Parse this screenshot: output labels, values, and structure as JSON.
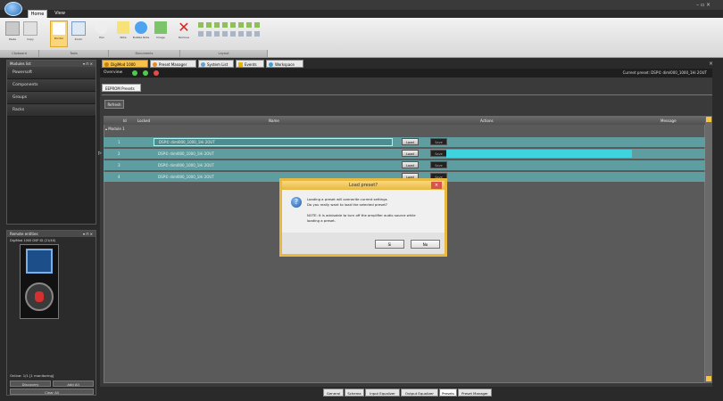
{
  "window": {
    "controls": "– ▫ ×"
  },
  "ribbon": {
    "tabs": [
      "Home",
      "View"
    ],
    "buttons": [
      "Paste",
      "Copy",
      "Pointer",
      "Zoom",
      "Pan",
      "Note",
      "Bubble Note",
      "Image",
      "Remove"
    ],
    "groups": [
      "Clipboard",
      "Tools",
      "Documents",
      "Layout"
    ]
  },
  "left": {
    "modules_title": "Modules list",
    "nav": [
      "Powersoft",
      "Components",
      "Groups",
      "Racks"
    ],
    "remote_title": "Remote entities",
    "device_name": "DigiMod 1000 DSP ID (21/4X)",
    "online_text": "Online: 1/1   [1 monitoring]",
    "buttons": {
      "discovery": "Discovery",
      "add_all": "Add All",
      "clear_all": "Clear All"
    }
  },
  "doc_tabs": [
    "DigiMod 1000",
    "Preset Manager",
    "System List",
    "Events",
    "Workspace"
  ],
  "overview": {
    "label": "Overview",
    "current_preset": "Current preset: DSP© diml000_1000_1Hi 2OUT"
  },
  "subtab": "EEPROM Presets",
  "refresh_label": "Refresh",
  "table": {
    "columns": [
      "Id",
      "Locked",
      "Name",
      "Actions",
      "Message"
    ],
    "group_label": "Module 1",
    "rows": [
      {
        "id": "1",
        "name": "DSP© diml000_1000_1Hi 2OUT"
      },
      {
        "id": "2",
        "name": "DSP© diml000_1000_1Hi 2OUT"
      },
      {
        "id": "3",
        "name": "DSP© diml000_1000_1Hi 2OUT"
      },
      {
        "id": "4",
        "name": "DSP© diml000_1000_1Hi 2OUT"
      }
    ],
    "load_label": "Load",
    "save_label": "Save"
  },
  "dialog": {
    "title": "Load preset?",
    "line1": "Loading a preset will overwrite current settings",
    "line2": "Do you really want to load the selected preset?",
    "note1": "NOTE: It is advisable to turn off the amplifier audio source while",
    "note2": "loading a preset.",
    "yes": "Si",
    "no": "No"
  },
  "bottom_tabs": [
    "General",
    "Schema",
    "Input Equalizer",
    "Output Equalizer",
    "Presets",
    "Preset Manager"
  ],
  "colors": {
    "accent": "#f7c14a",
    "row": "#5f9ea0",
    "highlight": "#3fd3e0"
  }
}
